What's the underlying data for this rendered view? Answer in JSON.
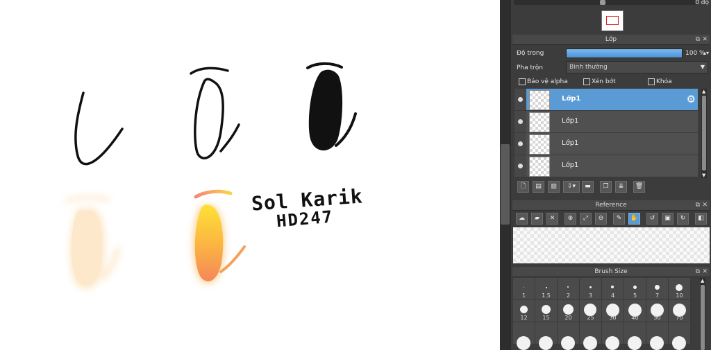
{
  "canvas": {
    "signature_line1": "Sol Karik",
    "signature_line2": "HD247",
    "colors": {
      "ink": "#111111",
      "skin": "#fde8cc",
      "gradient_top": "#fbe03b",
      "gradient_bottom": "#f58a4c",
      "brow_pink": "#f58a8a"
    }
  },
  "panel": {
    "top_value": "0 độ",
    "layer": {
      "title": "Lớp",
      "opacity_label": "Độ trong",
      "opacity_value": "100 %",
      "opacity_percent": 100,
      "blend_label": "Pha trộn",
      "blend_value": "Bình thường",
      "protect_alpha": "Bảo vệ alpha",
      "clip": "Xén bớt",
      "lock": "Khóa",
      "layers": [
        {
          "name": "Lớp1",
          "selected": true
        },
        {
          "name": "Lớp1",
          "selected": false
        },
        {
          "name": "Lớp1",
          "selected": false
        },
        {
          "name": "Lớp1",
          "selected": false
        }
      ]
    },
    "reference": {
      "title": "Reference"
    },
    "brush_size": {
      "title": "Brush Size",
      "sizes_row1": [
        "1",
        "1.5",
        "2",
        "3",
        "4",
        "5",
        "7",
        "10"
      ],
      "sizes_row2": [
        "12",
        "15",
        "20",
        "25",
        "30",
        "40",
        "50",
        "70"
      ]
    },
    "accent_color": "#5b9bd5"
  }
}
